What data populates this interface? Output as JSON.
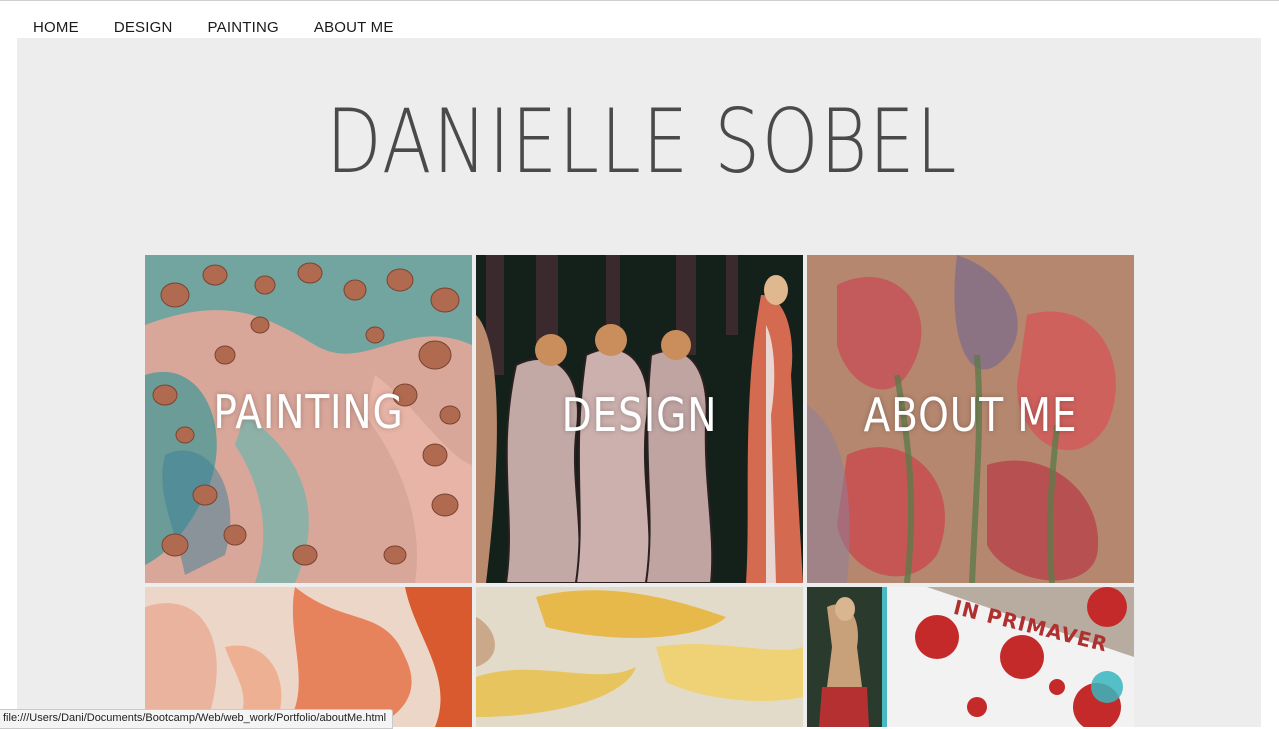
{
  "nav": {
    "items": [
      {
        "label": "HOME"
      },
      {
        "label": "DESIGN"
      },
      {
        "label": "PAINTING"
      },
      {
        "label": "ABOUT ME"
      }
    ]
  },
  "header": {
    "title": "DANIELLE SOBEL"
  },
  "tiles": [
    {
      "label": "PAINTING",
      "image": "seashells-painting"
    },
    {
      "label": "DESIGN",
      "image": "three-graces-illustration"
    },
    {
      "label": "ABOUT ME",
      "image": "red-poppies-painting"
    },
    {
      "label": "",
      "image": "orange-abstract-painting"
    },
    {
      "label": "",
      "image": "yellow-abstract-painting"
    },
    {
      "label": "",
      "image": "primavera-poster"
    }
  ],
  "poster_text": "IN PRIMAVER",
  "status_bar": {
    "url": "file:///Users/Dani/Documents/Bootcamp/Web/web_work/Portfolio/aboutMe.html"
  },
  "colors": {
    "panel_bg": "#ededed",
    "title_color": "#4a4a4a"
  }
}
